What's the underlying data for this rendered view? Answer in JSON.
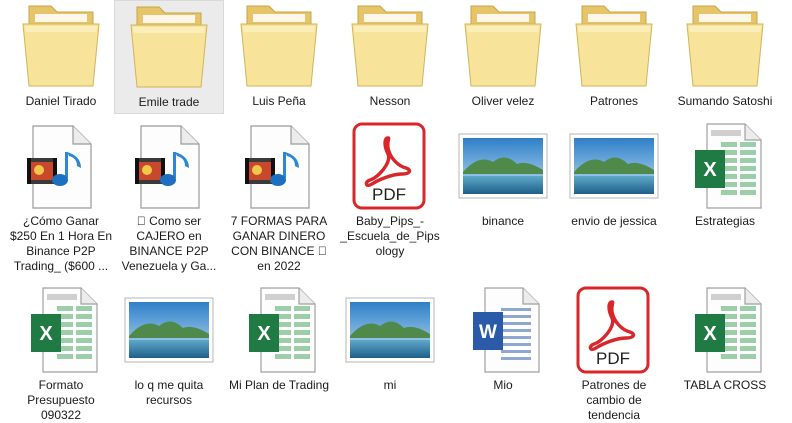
{
  "rows": [
    [
      {
        "label": "Daniel Tirado",
        "type": "folder",
        "selected": false
      },
      {
        "label": "Emile trade",
        "type": "folder",
        "selected": true
      },
      {
        "label": "Luis Peña",
        "type": "folder",
        "selected": false
      },
      {
        "label": "Nesson",
        "type": "folder",
        "selected": false
      },
      {
        "label": "Oliver velez",
        "type": "folder",
        "selected": false
      },
      {
        "label": "Patrones",
        "type": "folder",
        "selected": false
      },
      {
        "label": "Sumando Satoshi",
        "type": "folder",
        "selected": false
      }
    ],
    [
      {
        "label": "¿Cómo Ganar $250 En 1 Hora En Binance P2P Trading_ ($600 ...",
        "type": "media"
      },
      {
        "label": "\u0000 Como ser CAJERO en BINANCE P2P Venezuela y Ga...",
        "type": "media"
      },
      {
        "label": "7 FORMAS PARA GANAR DINERO CON BINANCE \u0000 en 2022",
        "type": "media"
      },
      {
        "label": "Baby_Pips_-_Escuela_de_Pipsology",
        "type": "pdf"
      },
      {
        "label": "binance",
        "type": "image"
      },
      {
        "label": "envio de jessica",
        "type": "image"
      },
      {
        "label": "Estrategias",
        "type": "excel"
      }
    ],
    [
      {
        "label": "Formato Presupuesto 090322",
        "type": "excel"
      },
      {
        "label": "lo q me quita recursos",
        "type": "image"
      },
      {
        "label": "Mi Plan de Trading",
        "type": "excel"
      },
      {
        "label": "mi",
        "type": "image"
      },
      {
        "label": "Mio",
        "type": "word"
      },
      {
        "label": "Patrones de cambio de tendencia",
        "type": "pdf"
      },
      {
        "label": "TABLA CROSS",
        "type": "excel"
      }
    ]
  ],
  "icon_names": {
    "folder": "folder-icon",
    "media": "media-file-icon",
    "pdf": "pdf-icon",
    "image": "image-file-icon",
    "excel": "excel-icon",
    "word": "word-icon"
  },
  "colors": {
    "folder_back": "#e6c56a",
    "folder_front": "#f7e39a",
    "pdf_red": "#d8262a",
    "excel_green": "#1f7a43",
    "word_blue": "#2a5aa8",
    "selection": "#ebebeb"
  }
}
